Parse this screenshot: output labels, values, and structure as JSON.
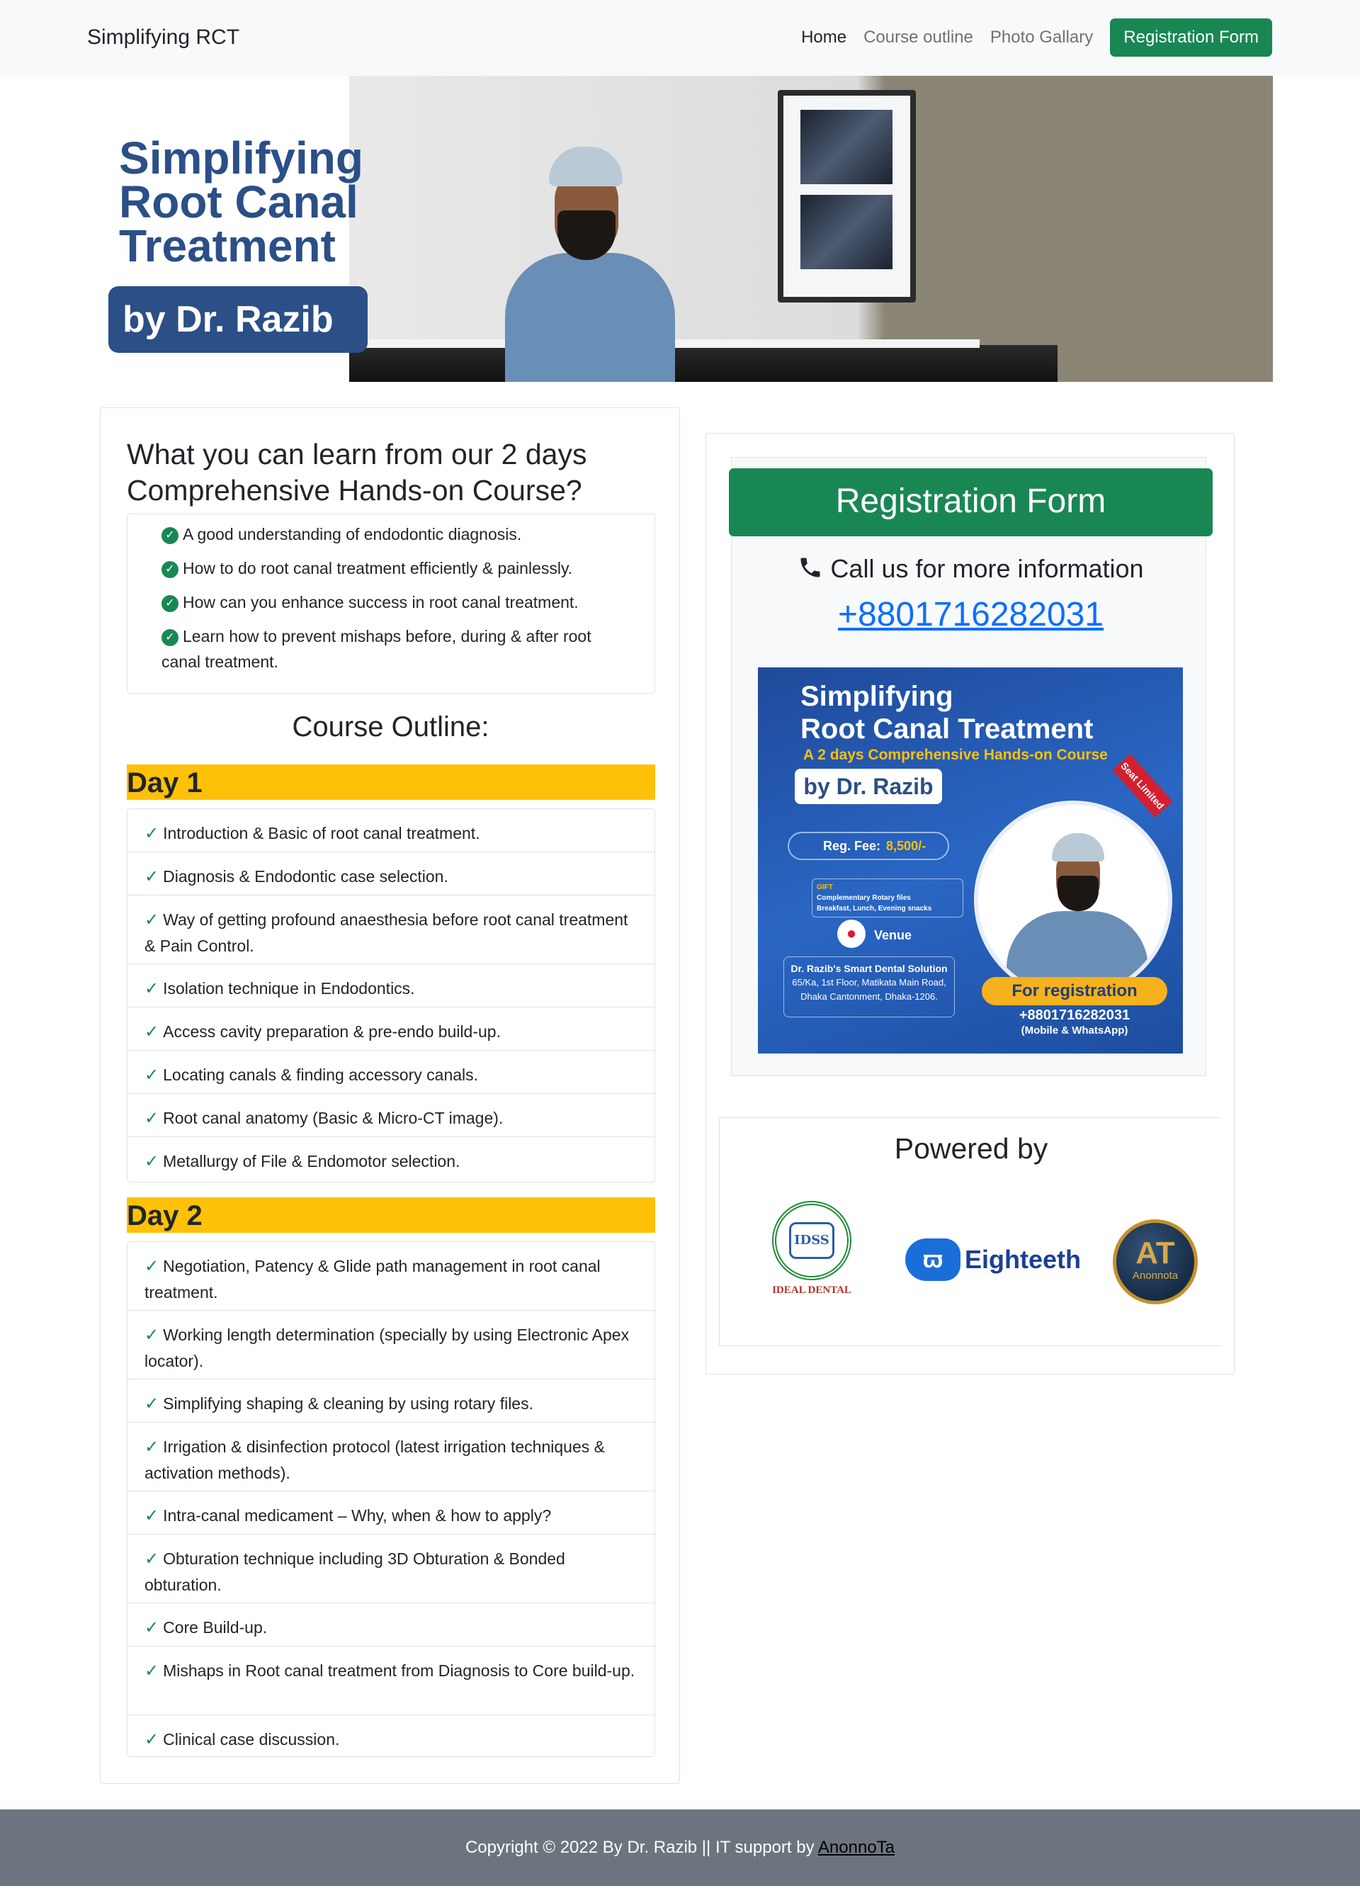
{
  "navbar": {
    "brand": "Simplifying RCT",
    "links": [
      "Home",
      "Course outline",
      "Photo Gallary"
    ],
    "cta": "Registration Form"
  },
  "hero": {
    "title_line1": "Simplifying",
    "title_line2": "Root Canal",
    "title_line3": "Treatment",
    "badge": "by Dr. Razib"
  },
  "learn": {
    "title": "What you can learn from our 2 days Comprehensive Hands-on Course?",
    "items": [
      "A good understanding of endodontic diagnosis.",
      "How to do root canal treatment efficiently & painlessly.",
      "How can you enhance success in root canal treatment.",
      "Learn how to prevent mishaps before, during & after root canal treatment."
    ]
  },
  "outline": {
    "title": "Course Outline:",
    "day1": {
      "label": "Day 1",
      "items": [
        "Introduction & Basic of root canal treatment.",
        "Diagnosis & Endodontic case selection.",
        "Way of getting profound anaesthesia before root canal treatment & Pain Control.",
        "Isolation technique in Endodontics.",
        "Access cavity preparation & pre-endo build-up.",
        "Locating canals & finding accessory canals.",
        "Root canal anatomy (Basic & Micro-CT image).",
        "Metallurgy of File & Endomotor selection."
      ]
    },
    "day2": {
      "label": "Day 2",
      "items": [
        "Negotiation, Patency & Glide path management in root canal treatment.",
        "Working length determination (specially by using Electronic Apex locator).",
        "Simplifying shaping & cleaning by using rotary files.",
        "Irrigation & disinfection protocol (latest irrigation techniques & activation methods).",
        "Intra-canal medicament – Why, when & how to apply?",
        "Obturation technique including 3D Obturation & Bonded obturation.",
        "Core Build-up.",
        "Mishaps in Root canal treatment from Diagnosis to Core build-up.",
        "Clinical case discussion."
      ]
    }
  },
  "registration": {
    "header": "Registration Form",
    "call_text": "Call us for more information",
    "phone": "+8801716282031"
  },
  "poster": {
    "title_line1": "Simplifying",
    "title_line2": "Root Canal Treatment",
    "subtitle": "A 2 days Comprehensive Hands-on Course",
    "by": "by Dr. Razib",
    "ribbon": "Seat Limited",
    "fee_label": "Reg. Fee:",
    "fee_value": "8,500/-",
    "gift_line1": "Complementary Rotary files",
    "gift_line2": "Breakfast, Lunch, Evening snacks",
    "gift_tag": "GIFT",
    "venue": "Venue",
    "address_name": "Dr. Razib's Smart Dental Solution",
    "address_line1": "65/Ka, 1st Floor, Matikata Main Road,",
    "address_line2": "Dhaka Cantonment, Dhaka-1206.",
    "reg_label": "For registration",
    "reg_phone": "+8801716282031",
    "reg_note": "(Mobile & WhatsApp)"
  },
  "powered": {
    "title": "Powered by",
    "logo1_mark": "IDSS",
    "logo1_caption": "IDEAL DENTAL",
    "logo2_word": "Eighteeth",
    "logo3_mark": "AT",
    "logo3_name": "Anonnota"
  },
  "footer": {
    "text": "Copyright © 2022 By Dr. Razib || IT support by ",
    "link": "AnonnoTa"
  },
  "colors": {
    "primary_green": "#198754",
    "day_yellow": "#ffc107",
    "link_blue": "#0d6efd",
    "footer_gray": "#6c757d"
  }
}
